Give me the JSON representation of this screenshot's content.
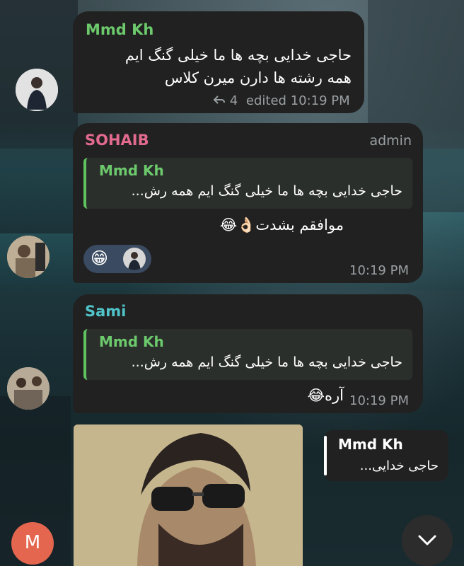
{
  "messages": [
    {
      "sender": "Mmd Kh",
      "lines": [
        "حاجی خدایی بچه ها ما خیلی گنگ ایم",
        "همه رشته ها دارن میرن کلاس"
      ],
      "reply_count": "4",
      "edited_time": "edited 10:19 PM",
      "colors": {
        "sender": "#6cc96c"
      }
    },
    {
      "sender": "SOHAIB",
      "role": "admin",
      "quote": {
        "name": "Mmd Kh",
        "text": "حاجی خدایی بچه ها ما خیلی گنگ ایم  همه رش..."
      },
      "text": "موافقم بشدت👌🏻😂",
      "reaction_emoji": "😁",
      "time": "10:19 PM",
      "colors": {
        "sender": "#e26a8f"
      }
    },
    {
      "sender": "Sami",
      "quote": {
        "name": "Mmd Kh",
        "text": "حاجی خدایی بچه ها ما خیلی گنگ ایم  همه رش..."
      },
      "text": "آره😂",
      "time": "10:19 PM",
      "colors": {
        "sender": "#4fc3c8"
      }
    }
  ],
  "photo_reply": {
    "name": "Mmd Kh",
    "text": "حاجی خدایی..."
  },
  "own_avatar": {
    "letter": "M",
    "color": "#e4664f"
  },
  "icons": {
    "reply": "reply-arrow-icon",
    "scroll": "chevron-down-icon"
  }
}
